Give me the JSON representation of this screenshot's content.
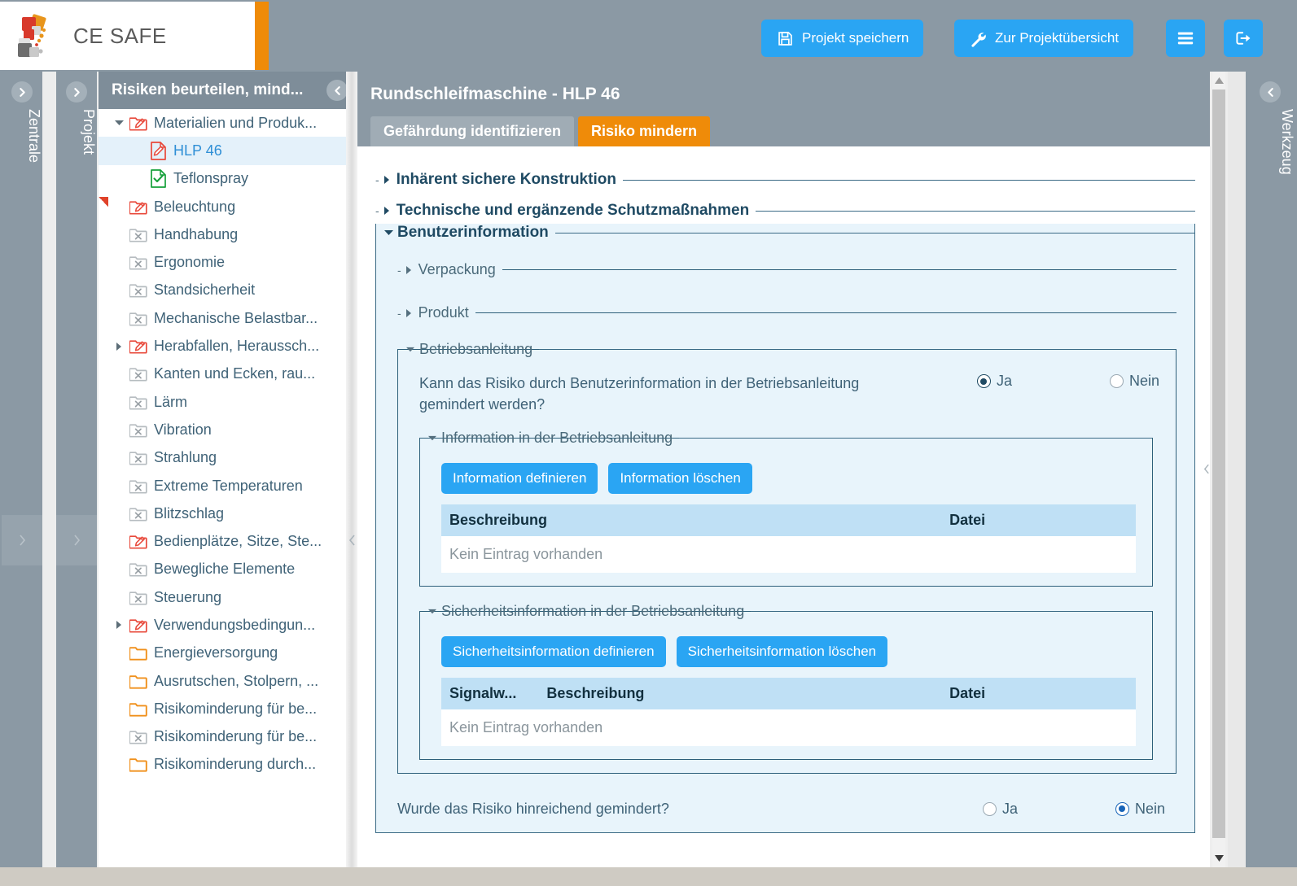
{
  "brand": {
    "name": "CE SAFE",
    "accent": "#ef8b09",
    "primary": "#2aa5f3"
  },
  "toolbar": {
    "save_label": "Projekt speichern",
    "overview_label": "Zur Projektübersicht",
    "menu_icon": "hamburger-icon",
    "logout_icon": "logout-icon",
    "save_icon": "floppy-disk-icon",
    "overview_icon": "wrench-icon"
  },
  "rails": {
    "zentrale": "Zentrale",
    "projekt": "Projekt",
    "werkzeug": "Werkzeug"
  },
  "tree": {
    "header": "Risiken beurteilen, mind...",
    "items": [
      {
        "label": "Materialien und Produk...",
        "icon": "folder-edit-red-icon",
        "indent": 0,
        "twisty": "down",
        "selected": false
      },
      {
        "label": "HLP 46",
        "icon": "document-edit-red-icon",
        "indent": 2,
        "twisty": "",
        "selected": true
      },
      {
        "label": "Teflonspray",
        "icon": "document-check-green-icon",
        "indent": 2,
        "twisty": "",
        "selected": false
      },
      {
        "label": "Beleuchtung",
        "icon": "folder-edit-red-icon",
        "indent": 1,
        "twisty": "",
        "selected": false
      },
      {
        "label": "Handhabung",
        "icon": "folder-x-grey-icon",
        "indent": 1,
        "twisty": "",
        "selected": false
      },
      {
        "label": "Ergonomie",
        "icon": "folder-x-grey-icon",
        "indent": 1,
        "twisty": "",
        "selected": false
      },
      {
        "label": "Standsicherheit",
        "icon": "folder-x-grey-icon",
        "indent": 1,
        "twisty": "",
        "selected": false
      },
      {
        "label": "Mechanische Belastbar...",
        "icon": "folder-x-grey-icon",
        "indent": 1,
        "twisty": "",
        "selected": false
      },
      {
        "label": "Herabfallen, Heraussch...",
        "icon": "folder-edit-red-icon",
        "indent": 0,
        "twisty": "right",
        "selected": false
      },
      {
        "label": "Kanten und Ecken, rau...",
        "icon": "folder-x-grey-icon",
        "indent": 1,
        "twisty": "",
        "selected": false
      },
      {
        "label": "Lärm",
        "icon": "folder-x-grey-icon",
        "indent": 1,
        "twisty": "",
        "selected": false
      },
      {
        "label": "Vibration",
        "icon": "folder-x-grey-icon",
        "indent": 1,
        "twisty": "",
        "selected": false
      },
      {
        "label": "Strahlung",
        "icon": "folder-x-grey-icon",
        "indent": 1,
        "twisty": "",
        "selected": false
      },
      {
        "label": "Extreme Temperaturen",
        "icon": "folder-x-grey-icon",
        "indent": 1,
        "twisty": "",
        "selected": false
      },
      {
        "label": "Blitzschlag",
        "icon": "folder-x-grey-icon",
        "indent": 1,
        "twisty": "",
        "selected": false
      },
      {
        "label": "Bedienplätze, Sitze, Ste...",
        "icon": "folder-edit-red-icon",
        "indent": 1,
        "twisty": "",
        "selected": false
      },
      {
        "label": "Bewegliche Elemente",
        "icon": "folder-x-grey-icon",
        "indent": 1,
        "twisty": "",
        "selected": false
      },
      {
        "label": "Steuerung",
        "icon": "folder-x-grey-icon",
        "indent": 1,
        "twisty": "",
        "selected": false
      },
      {
        "label": "Verwendungsbedingun...",
        "icon": "folder-edit-red-icon",
        "indent": 0,
        "twisty": "right",
        "selected": false
      },
      {
        "label": "Energieversorgung",
        "icon": "folder-orange-icon",
        "indent": 1,
        "twisty": "",
        "selected": false
      },
      {
        "label": "Ausrutschen, Stolpern, ...",
        "icon": "folder-orange-icon",
        "indent": 1,
        "twisty": "",
        "selected": false
      },
      {
        "label": "Risikominderung für be...",
        "icon": "folder-orange-icon",
        "indent": 1,
        "twisty": "",
        "selected": false
      },
      {
        "label": "Risikominderung für be...",
        "icon": "folder-x-grey-icon",
        "indent": 1,
        "twisty": "",
        "selected": false
      },
      {
        "label": "Risikominderung durch...",
        "icon": "folder-orange-icon",
        "indent": 1,
        "twisty": "",
        "selected": false
      }
    ]
  },
  "main": {
    "title": "Rundschleifmaschine - HLP 46",
    "tabs": [
      {
        "label": "Gefährdung identifizieren",
        "active": false
      },
      {
        "label": "Risiko mindern",
        "active": true
      }
    ],
    "sections": [
      {
        "title": "Inhärent sichere Konstruktion",
        "open": false
      },
      {
        "title": "Technische und ergänzende Schutzmaßnahmen",
        "open": false
      },
      {
        "title": "Benutzerinformation",
        "open": true
      }
    ],
    "subsections": [
      {
        "title": "Verpackung",
        "open": false
      },
      {
        "title": "Produkt",
        "open": false
      }
    ],
    "betriebsanleitung": {
      "title": "Betriebsanleitung",
      "question": "Kann das Risiko durch Benutzerinformation in der Betriebsanleitung gemindert werden?",
      "answer_yes": "Ja",
      "answer_no": "Nein",
      "selected": "Ja"
    },
    "info_box": {
      "title": "Information in der Betriebsanleitung",
      "define_label": "Information definieren",
      "delete_label": "Information löschen",
      "columns": [
        "Beschreibung",
        "Datei"
      ],
      "empty_text": "Kein Eintrag vorhanden"
    },
    "safety_box": {
      "title": "Sicherheitsinformation in der Betriebsanleitung",
      "define_label": "Sicherheitsinformation definieren",
      "delete_label": "Sicherheitsinformation löschen",
      "columns": [
        "Signalw...",
        "Beschreibung",
        "Datei"
      ],
      "empty_text": "Kein Eintrag vorhanden"
    },
    "final_question": {
      "text": "Wurde das Risiko hinreichend gemindert?",
      "answer_yes": "Ja",
      "answer_no": "Nein",
      "selected": "Nein"
    }
  }
}
